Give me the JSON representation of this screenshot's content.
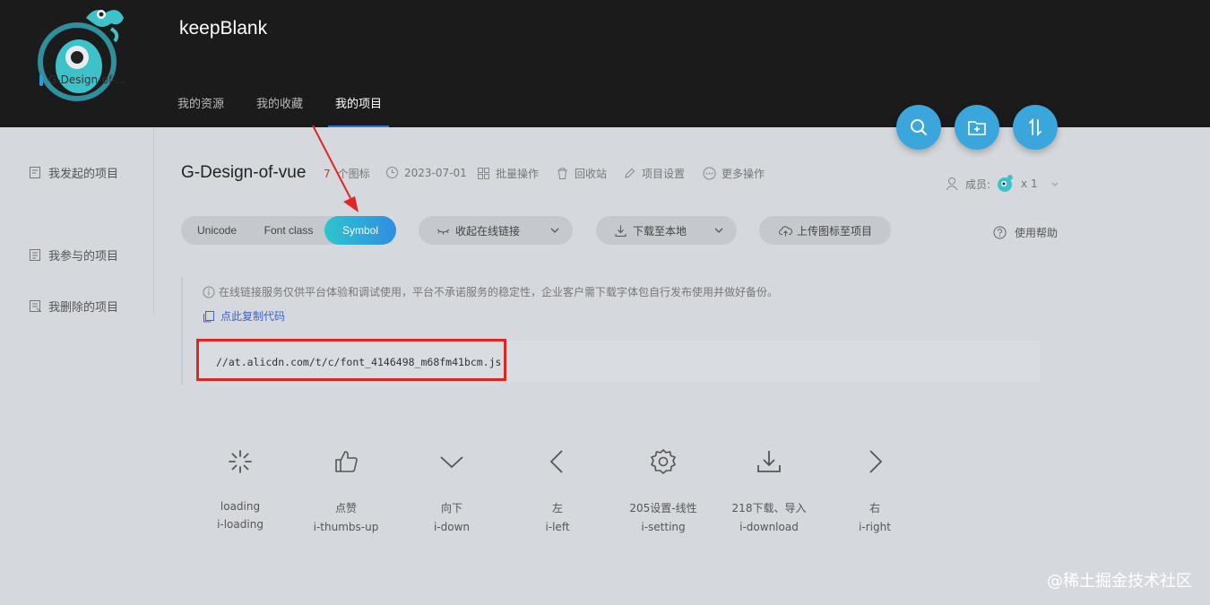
{
  "header": {
    "username": "keepBlank",
    "nav": [
      "我的资源",
      "我的收藏",
      "我的项目"
    ]
  },
  "fab": [
    "search-icon",
    "add-folder-icon",
    "sort-icon"
  ],
  "sidebar": {
    "items": [
      "我发起的项目",
      "我参与的项目",
      "我删除的项目"
    ],
    "sub_item": "G-Design-of-..."
  },
  "project": {
    "title": "G-Design-of-vue",
    "icon_count": "7",
    "icon_count_suffix": "个图标",
    "date": "2023-07-01",
    "actions": [
      "批量操作",
      "回收站",
      "项目设置",
      "更多操作"
    ],
    "members_label": "成员:",
    "members_count": "x 1"
  },
  "tabs": {
    "items": [
      "Unicode",
      "Font class",
      "Symbol"
    ],
    "active": "Symbol"
  },
  "buttons": {
    "collapse_link": "收起在线链接",
    "download_local": "下载至本地",
    "upload_icons": "上传图标至项目",
    "help": "使用帮助"
  },
  "notice": {
    "text": "在线链接服务仅供平台体验和调试使用，平台不承诺服务的稳定性，企业客户需下载字体包自行发布使用并做好备份。",
    "copy_link": "点此复制代码"
  },
  "code_url": "//at.alicdn.com/t/c/font_4146498_m68fm41bcm.js",
  "icons": [
    {
      "name": "loading",
      "code": "i-loading",
      "glyph": "loading-icon"
    },
    {
      "name": "点赞",
      "code": "i-thumbs-up",
      "glyph": "thumbs-up-icon"
    },
    {
      "name": "向下",
      "code": "i-down",
      "glyph": "down-icon"
    },
    {
      "name": "左",
      "code": "i-left",
      "glyph": "left-icon"
    },
    {
      "name": "205设置-线性",
      "code": "i-setting",
      "glyph": "setting-icon"
    },
    {
      "name": "218下载、导入",
      "code": "i-download",
      "glyph": "download-icon"
    },
    {
      "name": "右",
      "code": "i-right",
      "glyph": "right-icon"
    }
  ],
  "watermark": "@稀土掘金技术社区",
  "colors": {
    "header_bg": "#1b1b1b",
    "body_bg": "#d5d9de",
    "accent": "#3aa6dc",
    "highlight_border": "#e02525"
  }
}
